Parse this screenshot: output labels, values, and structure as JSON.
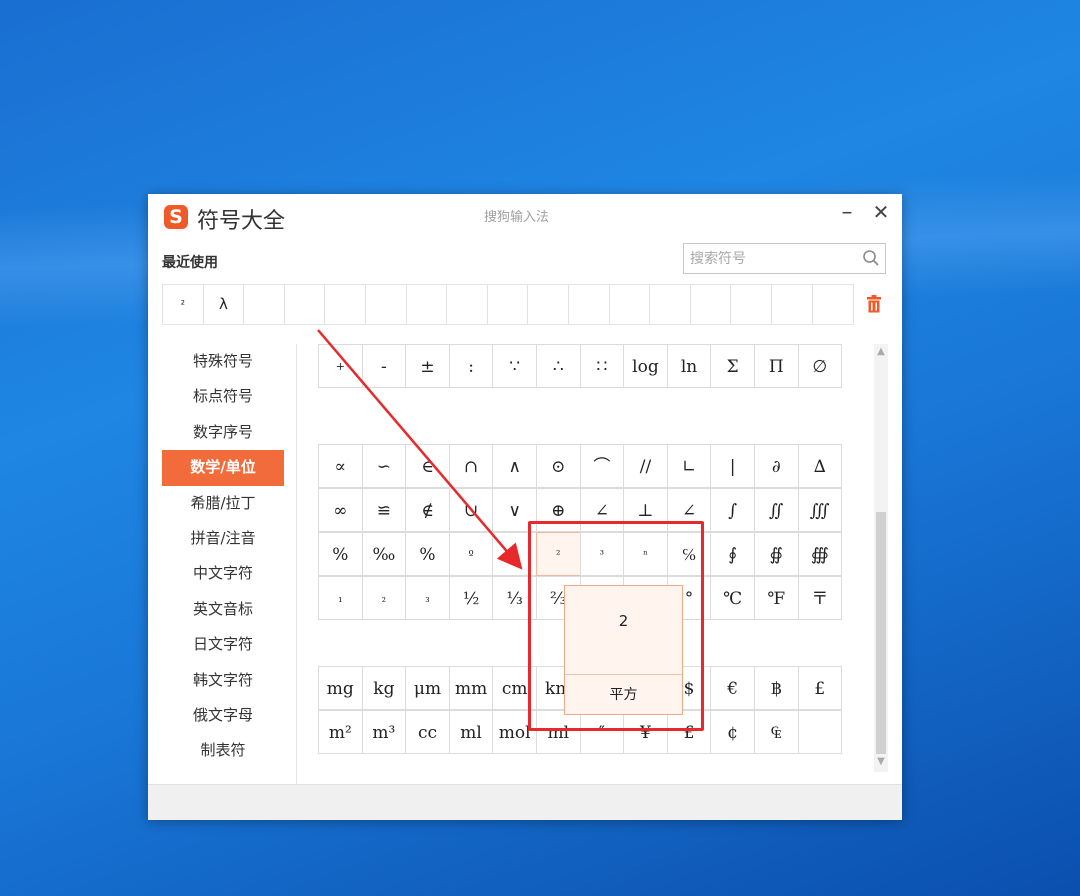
{
  "window": {
    "title": "符号大全",
    "logo": "S",
    "ime_name": "搜狗输入法",
    "min_label": "–",
    "close_label": "✕"
  },
  "recent": {
    "label": "最近使用",
    "symbols": [
      "²",
      "λ",
      "",
      "",
      "",
      "",
      "",
      "",
      "",
      "",
      "",
      "",
      "",
      "",
      "",
      "",
      ""
    ]
  },
  "search": {
    "placeholder": "搜索符号"
  },
  "sidebar": {
    "items": [
      {
        "label": "特殊符号"
      },
      {
        "label": "标点符号"
      },
      {
        "label": "数字序号"
      },
      {
        "label": "数学/单位",
        "active": true
      },
      {
        "label": "希腊/拉丁"
      },
      {
        "label": "拼音/注音"
      },
      {
        "label": "中文字符"
      },
      {
        "label": "英文音标"
      },
      {
        "label": "日文字符"
      },
      {
        "label": "韩文字符"
      },
      {
        "label": "俄文字母"
      },
      {
        "label": "制表符"
      }
    ]
  },
  "grid": {
    "rows": [
      [
        "+",
        "-",
        "±",
        ":",
        "∵",
        "∴",
        "∷",
        "log",
        "ln",
        "Σ",
        "Π",
        "∅"
      ],
      [
        "∝",
        "∽",
        "∈",
        "∩",
        "∧",
        "⊙",
        "⌒",
        "//",
        "∟",
        "|",
        "∂",
        "∆"
      ],
      [
        "∞",
        "≌",
        "∉",
        "∪",
        "∨",
        "⊕",
        "∠",
        "⊥",
        "∠",
        "∫",
        "∬",
        "∭"
      ],
      [
        "%",
        "‰",
        "%",
        "º",
        "",
        "²",
        "³",
        "ⁿ",
        "℅",
        "∮",
        "∯",
        "∰"
      ],
      [
        "₁",
        "₂",
        "₃",
        "½",
        "⅓",
        "⅔",
        "",
        "",
        "°",
        "℃",
        "℉",
        "〒"
      ],
      [
        "mg",
        "kg",
        "μm",
        "mm",
        "cm",
        "km",
        "",
        "",
        "$",
        "€",
        "฿",
        "£"
      ],
      [
        "m²",
        "m³",
        "cc",
        "ml",
        "mol",
        "ml",
        "″",
        "¥",
        "£",
        "¢",
        "₠",
        ""
      ]
    ]
  },
  "tooltip": {
    "symbol": "2",
    "name": "平方"
  },
  "colors": {
    "accent": "#f26b3a",
    "highlight": "#e8292b"
  }
}
